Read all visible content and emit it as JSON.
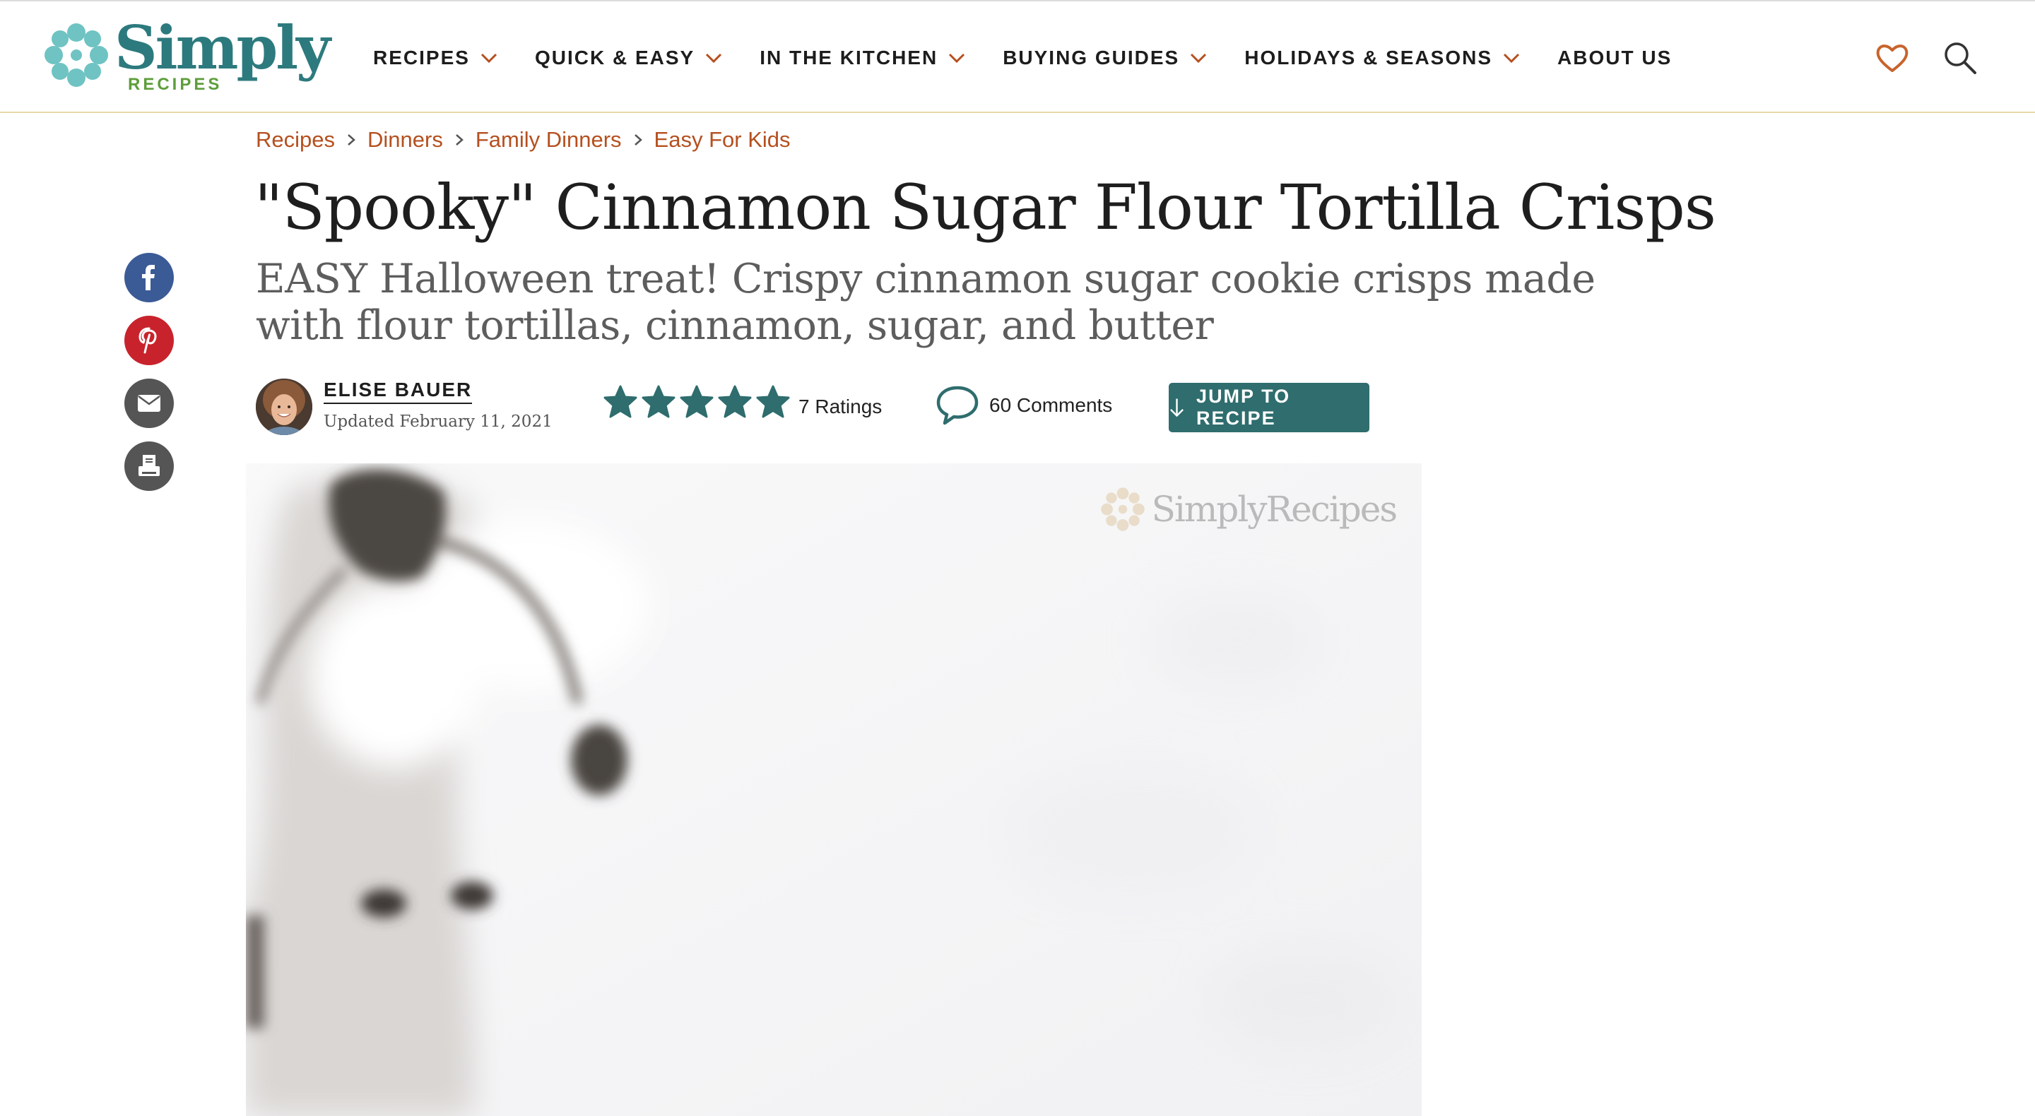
{
  "brand": {
    "word": "Simply",
    "sub": "RECIPES",
    "primary": "#2c7a7e",
    "green": "#5e9e3b",
    "flower": "#6fc3c3"
  },
  "nav": {
    "items": [
      {
        "label": "RECIPES",
        "has_dropdown": true
      },
      {
        "label": "QUICK & EASY",
        "has_dropdown": true
      },
      {
        "label": "IN THE KITCHEN",
        "has_dropdown": true
      },
      {
        "label": "BUYING GUIDES",
        "has_dropdown": true
      },
      {
        "label": "HOLIDAYS & SEASONS",
        "has_dropdown": true
      },
      {
        "label": "ABOUT US",
        "has_dropdown": false
      }
    ],
    "icons": [
      "heart-icon",
      "search-icon"
    ]
  },
  "breadcrumb": [
    "Recipes",
    "Dinners",
    "Family Dinners",
    "Easy For Kids"
  ],
  "article": {
    "title": "\"Spooky\" Cinnamon Sugar Flour Tortilla Crisps",
    "subtitle": "EASY Halloween treat! Crispy cinnamon sugar cookie crisps made with flour tortillas, cinnamon, sugar, and butter"
  },
  "social": [
    "facebook-icon",
    "pinterest-icon",
    "email-icon",
    "print-icon"
  ],
  "byline": {
    "author": "ELISE BAUER",
    "updated": "Updated February 11, 2021",
    "rating_stars": 5,
    "ratings": "7 Ratings",
    "comments": "60 Comments",
    "jump_label": "JUMP TO RECIPE"
  },
  "hero": {
    "watermark": "SimplyRecipes"
  },
  "colors": {
    "accent": "#2f6d6e",
    "link": "#b5501f",
    "facebook": "#3b5b96",
    "pinterest": "#c8232c",
    "grey_icon": "#555555",
    "header_border": "#e8d9a8"
  }
}
